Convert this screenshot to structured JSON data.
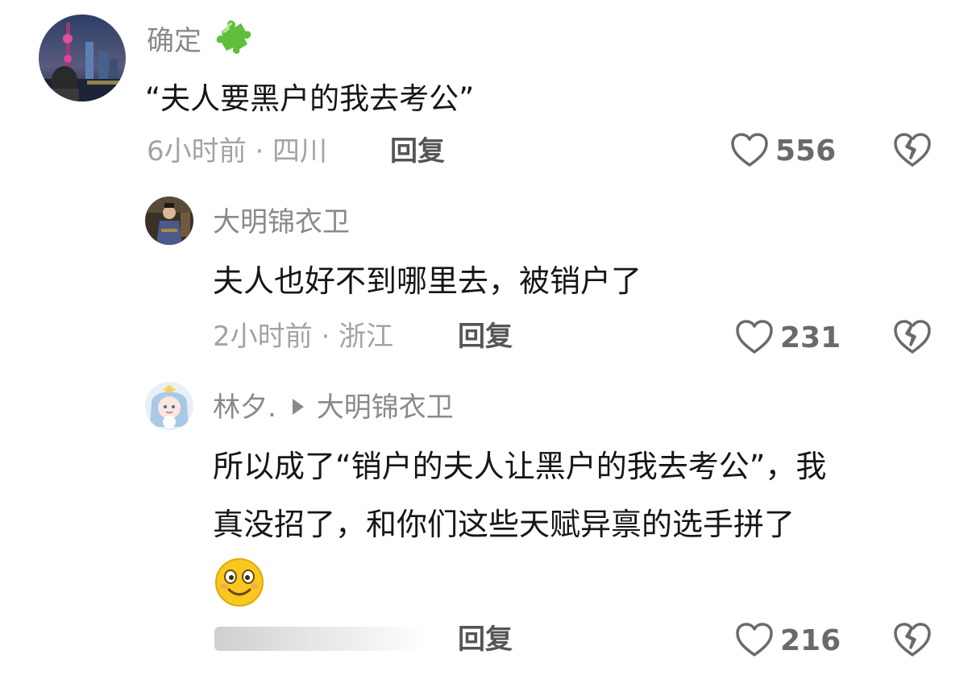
{
  "comments": [
    {
      "username": "确定",
      "badge_icon": "puzzle-piece-icon",
      "text": "“夫人要黑户的我去考公”",
      "meta": "6小时前 · 四川",
      "reply_label": "回复",
      "likes": "556"
    },
    {
      "username": "大明锦衣卫",
      "text": "夫人也好不到哪里去，被销户了",
      "meta": "2小时前 · 浙江",
      "reply_label": "回复",
      "likes": "231"
    },
    {
      "username": "林夕.",
      "reply_to": "大明锦衣卫",
      "text_line1": "所以成了“销户的夫人让黑户的我去考公”，我",
      "text_line2": "真没招了，和你们这些天赋异禀的选手拼了",
      "emoji_icon": "smiling-emoji-icon",
      "reply_label": "回复",
      "likes": "216"
    }
  ],
  "colors": {
    "username": "#8a8a8a",
    "content": "#161616",
    "meta": "#a3a3a3",
    "reply": "#555555",
    "icon": "#6a6a6a",
    "badge_green": "#5fbf3d"
  }
}
